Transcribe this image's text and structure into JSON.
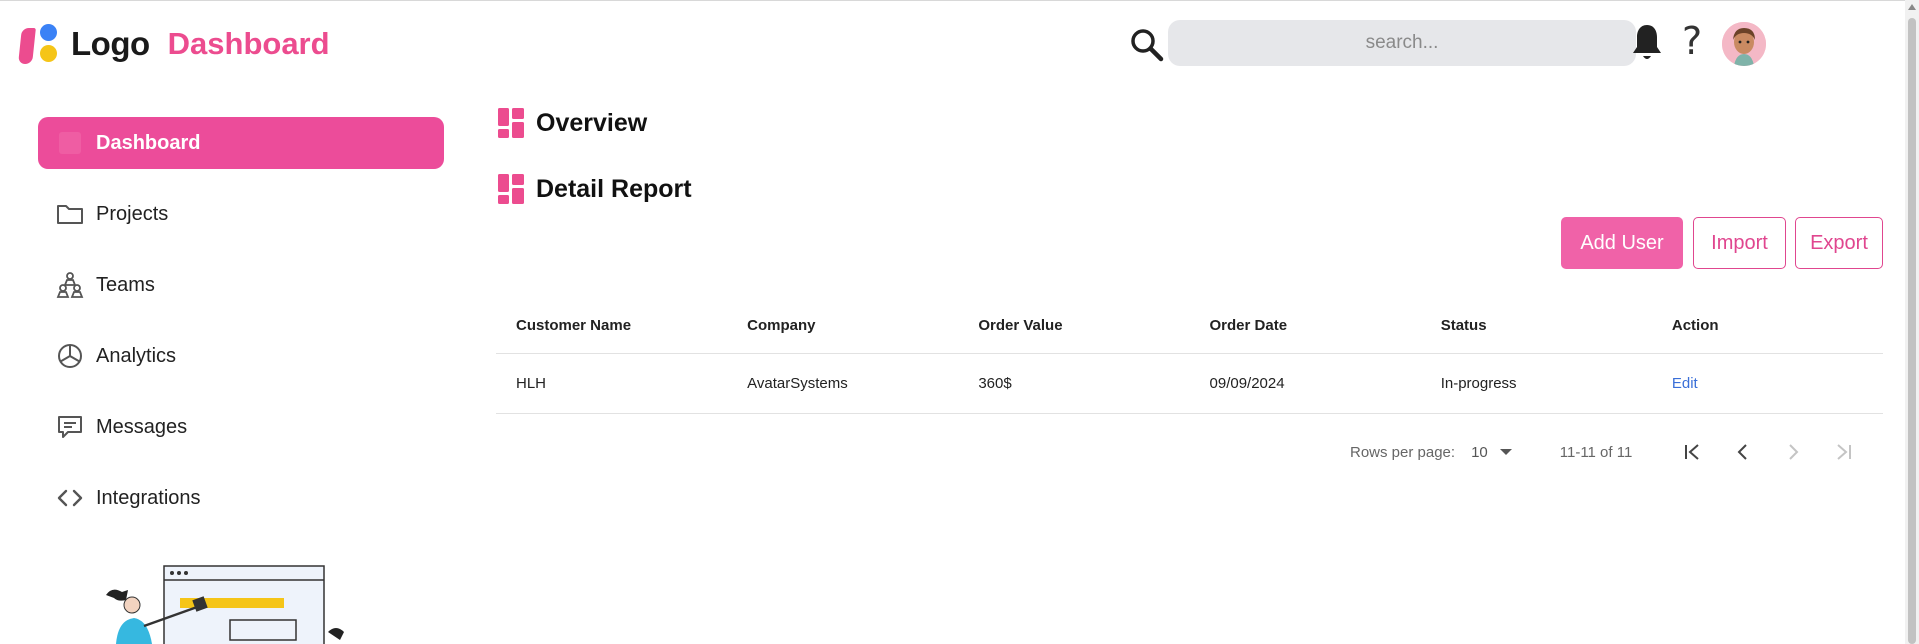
{
  "header": {
    "logo_text": "Logo",
    "app_title": "Dashboard",
    "search": {
      "placeholder": "search..."
    },
    "icons": [
      "search-icon",
      "bell-icon",
      "help-icon",
      "avatar"
    ]
  },
  "sidebar": {
    "items": [
      {
        "label": "Dashboard",
        "icon": "dashboard-icon",
        "active": true
      },
      {
        "label": "Projects",
        "icon": "folder-icon",
        "active": false
      },
      {
        "label": "Teams",
        "icon": "teams-icon",
        "active": false
      },
      {
        "label": "Analytics",
        "icon": "pie-chart-icon",
        "active": false
      },
      {
        "label": "Messages",
        "icon": "message-icon",
        "active": false
      },
      {
        "label": "Integrations",
        "icon": "code-icon",
        "active": false
      }
    ]
  },
  "main": {
    "overview_title": "Overview",
    "detail_title": "Detail Report",
    "buttons": {
      "add_user": "Add User",
      "import": "Import",
      "export": "Export"
    },
    "table": {
      "columns": [
        "Customer Name",
        "Company",
        "Order Value",
        "Order Date",
        "Status",
        "Action"
      ],
      "rows": [
        [
          "HLH",
          "AvatarSystems",
          "360$",
          "09/09/2024",
          "In-progress",
          "Edit"
        ]
      ]
    },
    "pagination": {
      "rows_per_page_label": "Rows per page:",
      "rows_per_page_value": "10",
      "page_info": "11-11 of 11"
    }
  },
  "colors": {
    "accent": "#ec4c8f",
    "active_nav": "#ec4c9a",
    "primary_button": "#f062a8",
    "link": "#3a6fd8",
    "logo_blue": "#3b82f6",
    "logo_yellow": "#f5c518"
  }
}
